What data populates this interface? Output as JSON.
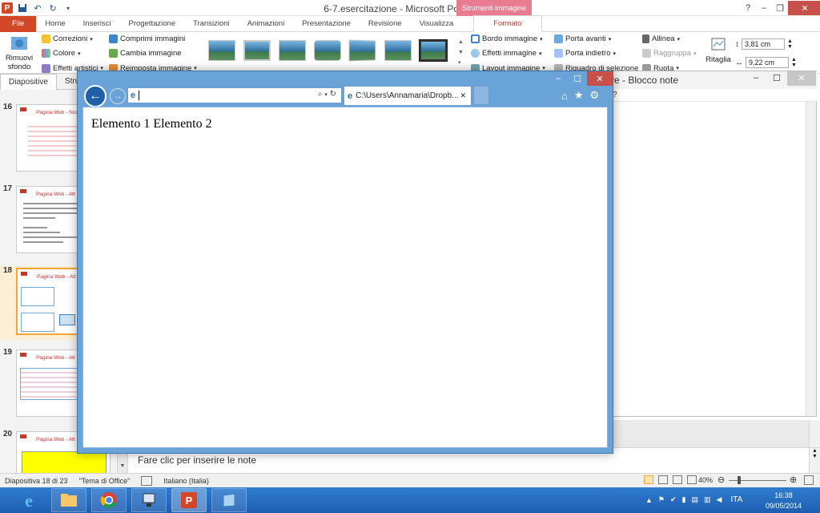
{
  "title_bar": {
    "doc_title": "6-7.esercitazione - Microsoft PowerPoint",
    "context_tab": "Strumenti immagine",
    "minimize": "–",
    "restore": "❐",
    "close": "✕"
  },
  "ribbon_tabs": [
    "File",
    "Home",
    "Inserisci",
    "Progettazione",
    "Transizioni",
    "Animazioni",
    "Presentazione",
    "Revisione",
    "Visualizza"
  ],
  "ribbon_active_tab": "Formato",
  "ribbon": {
    "remove_bg_line1": "Rimuovi",
    "remove_bg_line2": "sfondo",
    "corrections": "Correzioni",
    "color": "Colore",
    "artistic": "Effetti artistici",
    "compress": "Comprimi immagini",
    "change": "Cambia immagine",
    "reset": "Reimposta immagine",
    "border": "Bordo immagine",
    "effects": "Effetti immagine",
    "layout": "Layout immagine",
    "bring_forward": "Porta avanti",
    "send_backward": "Porta indietro",
    "selection_pane": "Riquadro di selezione",
    "align": "Allinea",
    "group": "Raggruppa",
    "rotate": "Ruota",
    "crop": "Ritaglia",
    "height": "3,81 cm",
    "width": "9,22 cm"
  },
  "slide_panel": {
    "tab_slides": "Diapositive",
    "tab_outline": "Stru",
    "slides": [
      {
        "num": "16",
        "title": "Pagina Web - Nome"
      },
      {
        "num": "17",
        "title": "Pagina Web - Att"
      },
      {
        "num": "18",
        "title": "Pagina Web - Att"
      },
      {
        "num": "19",
        "title": "Pagina Web - Att"
      },
      {
        "num": "20",
        "title": "Pagina Web - Att"
      }
    ]
  },
  "notepad": {
    "title": "ve - Blocco note",
    "menu_fragment": "?"
  },
  "ie": {
    "address_value": "",
    "tab_label": "C:\\Users\\Annamaria\\Dropb...",
    "page_text": "Elemento 1 Elemento 2"
  },
  "notes": {
    "placeholder": "Fare clic per inserire le note"
  },
  "status_bar": {
    "slide_info": "Diapositiva 18 di 23",
    "theme": "\"Tema di Office\"",
    "language": "Italiano (Italia)",
    "zoom": "40%"
  },
  "taskbar": {
    "lang": "ITA",
    "time": "16:38",
    "date": "09/05/2014"
  },
  "colors": {
    "accent": "#d24726",
    "context_tab": "#e97c91",
    "ie_frame": "#6aa3d8",
    "taskbar": "#2f7ccf"
  }
}
